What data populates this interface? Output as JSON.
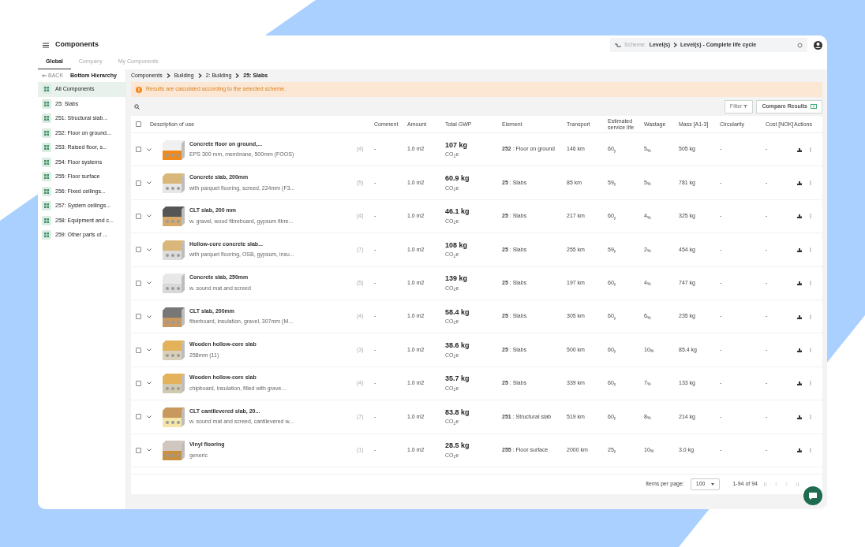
{
  "header": {
    "title": "Components",
    "scheme": {
      "label": "Scheme:",
      "levels": [
        "Level(s)",
        "Level(s) - Complete life cycle"
      ]
    }
  },
  "tabs": [
    {
      "label": "Global",
      "selected": true
    },
    {
      "label": "Company",
      "selected": false
    },
    {
      "label": "My Components",
      "selected": false
    }
  ],
  "sidebar": {
    "back": "BACK",
    "title": "Bottom Hierarchy",
    "items": [
      {
        "label": "All Components",
        "selected": true
      },
      {
        "label": "25: Slabs",
        "selected": false
      },
      {
        "label": "251: Structural slab...",
        "selected": false
      },
      {
        "label": "252: Floor on ground...",
        "selected": false
      },
      {
        "label": "253: Raised floor, s...",
        "selected": false
      },
      {
        "label": "254: Floor systems",
        "selected": false
      },
      {
        "label": "255: Floor surface",
        "selected": false
      },
      {
        "label": "256: Fixed ceilings...",
        "selected": false
      },
      {
        "label": "257: System ceilings...",
        "selected": false
      },
      {
        "label": "258: Equipment and c...",
        "selected": false
      },
      {
        "label": "259: Other parts of ...",
        "selected": false
      }
    ]
  },
  "breadcrumbs": [
    "Components",
    "Building",
    "2: Building",
    "25: Slabs"
  ],
  "notice": "Results are calculated according to the selected scheme.",
  "toolbar": {
    "filter": "Filter",
    "compare": "Compare Results"
  },
  "table": {
    "all_checked": false,
    "columns": [
      "Description of use",
      "Comment",
      "Amount",
      "Total GWP",
      "Element",
      "Transport",
      "Estimated service life",
      "Wastage",
      "Mass [A1-3]",
      "Circularity",
      "Cost [NOK]",
      "Actions"
    ],
    "rows": [
      {
        "checked": false,
        "name": "Concrete floor on ground,...",
        "detail": "EPS 300 mm, membrane, 500mm (FOOS)",
        "count": "(4)",
        "comment": "-",
        "amount": "1.0 m2",
        "gwp": "107 kg",
        "unit": "CO$_{2}$e",
        "element": "**252** : Floor on ground",
        "transport": "146 km",
        "life": "60$_{y}$",
        "wastage": "5$_{%}$",
        "mass": "505 kg",
        "circularity": "-",
        "cost": "-"
      },
      {
        "checked": false,
        "name": "Concrete slab, 200mm",
        "detail": "with parquet flooring, screed, 224mm (F3...",
        "count": "(5)",
        "comment": "-",
        "amount": "1.0 m2",
        "gwp": "60.9 kg",
        "unit": "CO$_{2}$e",
        "element": "**25** : Slabs",
        "transport": "85 km",
        "life": "59$_{y}$",
        "wastage": "5$_{%}$",
        "mass": "781 kg",
        "circularity": "-",
        "cost": "-"
      },
      {
        "checked": false,
        "name": "CLT slab, 200 mm",
        "detail": "w. gravel, wood fibreboard, gypsum fibre...",
        "count": "(4)",
        "comment": "-",
        "amount": "1.0 m2",
        "gwp": "46.1 kg",
        "unit": "CO$_{2}$e",
        "element": "**25** : Slabs",
        "transport": "217 km",
        "life": "60$_{y}$",
        "wastage": "4$_{%}$",
        "mass": "325 kg",
        "circularity": "-",
        "cost": "-"
      },
      {
        "checked": false,
        "name": "Hollow-core concrete slab...",
        "detail": "with parquet flooring, OSB, gypsum, insu...",
        "count": "(7)",
        "comment": "-",
        "amount": "1.0 m2",
        "gwp": "108 kg",
        "unit": "CO$_{2}$e",
        "element": "**25** : Slabs",
        "transport": "255 km",
        "life": "59$_{y}$",
        "wastage": "2$_{%}$",
        "mass": "454 kg",
        "circularity": "-",
        "cost": "-"
      },
      {
        "checked": false,
        "name": "Concrete slab, 250mm",
        "detail": "w. sound mat and screed",
        "count": "(5)",
        "comment": "-",
        "amount": "1.0 m2",
        "gwp": "139 kg",
        "unit": "CO$_{2}$e",
        "element": "**25** : Slabs",
        "transport": "197 km",
        "life": "60$_{y}$",
        "wastage": "4$_{%}$",
        "mass": "747 kg",
        "circularity": "-",
        "cost": "-"
      },
      {
        "checked": false,
        "name": "CLT slab, 200mm",
        "detail": "fiberboard, insulation, gravel, 307mm (M...",
        "count": "(4)",
        "comment": "-",
        "amount": "1.0 m2",
        "gwp": "58.4 kg",
        "unit": "CO$_{2}$e",
        "element": "**25** : Slabs",
        "transport": "305 km",
        "life": "60$_{y}$",
        "wastage": "6$_{%}$",
        "mass": "235 kg",
        "circularity": "-",
        "cost": "-"
      },
      {
        "checked": false,
        "name": "Wooden hollow-core slab",
        "detail": "258mm (11)",
        "count": "(3)",
        "comment": "-",
        "amount": "1.0 m2",
        "gwp": "38.6 kg",
        "unit": "CO$_{2}$e",
        "element": "**25** : Slabs",
        "transport": "500 km",
        "life": "60$_{y}$",
        "wastage": "10$_{%}$",
        "mass": "85.4 kg",
        "circularity": "-",
        "cost": "-"
      },
      {
        "checked": false,
        "name": "Wooden hollow-core slab",
        "detail": "chipboard, insulation, filled with grave...",
        "count": "(4)",
        "comment": "-",
        "amount": "1.0 m2",
        "gwp": "35.7 kg",
        "unit": "CO$_{2}$e",
        "element": "**25** : Slabs",
        "transport": "339 km",
        "life": "60$_{y}$",
        "wastage": "7$_{%}$",
        "mass": "133 kg",
        "circularity": "-",
        "cost": "-"
      },
      {
        "checked": false,
        "name": "CLT cantilevered slab, 20...",
        "detail": "w. sound mat and screed, cantilevered w...",
        "count": "(7)",
        "comment": "-",
        "amount": "1.0 m2",
        "gwp": "83.8 kg",
        "unit": "CO$_{2}$e",
        "element": "**251** : Structural slab",
        "transport": "519 km",
        "life": "60$_{y}$",
        "wastage": "8$_{%}$",
        "mass": "214 kg",
        "circularity": "-",
        "cost": "-"
      },
      {
        "checked": false,
        "name": "Vinyl flooring",
        "detail": "generic",
        "count": "(1)",
        "comment": "-",
        "amount": "1.0 m2",
        "gwp": "28.5 kg",
        "unit": "CO$_{2}$e",
        "element": "**255** : Floor surface",
        "transport": "2000 km",
        "life": "25$_{y}$",
        "wastage": "10$_{%}$",
        "mass": "3.0 kg",
        "circularity": "-",
        "cost": "-"
      }
    ]
  },
  "pagination": {
    "label": "Items per page:",
    "per_page": "100",
    "range": "1-94 of 94"
  }
}
